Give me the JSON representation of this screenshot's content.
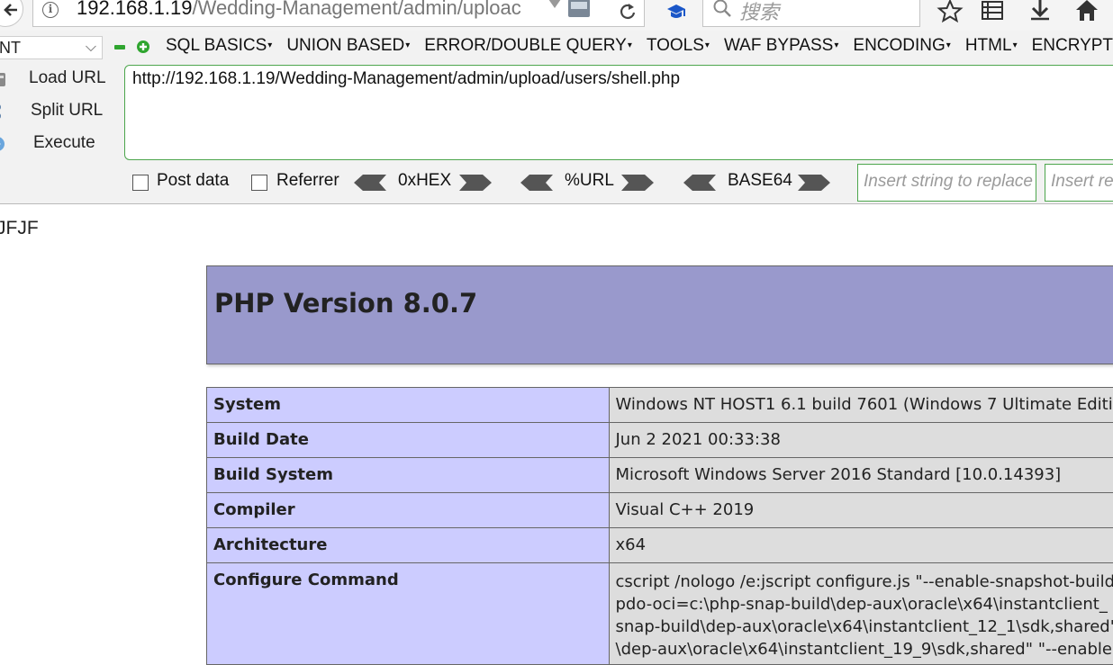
{
  "browser": {
    "url_host": "192.168.1.19",
    "url_path": "/Wedding-Management/admin/uploac",
    "search_placeholder": "搜索"
  },
  "hackbar": {
    "select_value": "NT",
    "menu": [
      "SQL BASICS",
      "UNION BASED",
      "ERROR/DOUBLE QUERY",
      "TOOLS",
      "WAF BYPASS",
      "ENCODING",
      "HTML",
      "ENCRYPTION"
    ],
    "load_url": "Load URL",
    "split_url": "Split URL",
    "execute": "Execute",
    "url_value": "http://192.168.1.19/Wedding-Management/admin/upload/users/shell.php",
    "post_data": "Post data",
    "referrer": "Referrer",
    "hex": "0xHEX",
    "url_enc": "%URL",
    "base64": "BASE64",
    "replace_placeholder": "Insert string to replace",
    "replace_with_placeholder": "Insert re"
  },
  "page": {
    "pretext": "JFJF",
    "php_title": "PHP Version 8.0.7",
    "rows": [
      {
        "key": "System",
        "value": "Windows NT HOST1 6.1 build 7601 (Windows 7 Ultimate Editi"
      },
      {
        "key": "Build Date",
        "value": "Jun 2 2021 00:33:38"
      },
      {
        "key": "Build System",
        "value": "Microsoft Windows Server 2016 Standard [10.0.14393]"
      },
      {
        "key": "Compiler",
        "value": "Visual C++ 2019"
      },
      {
        "key": "Architecture",
        "value": "x64"
      }
    ],
    "configure": {
      "key": "Configure Command",
      "lines": [
        "cscript /nologo /e:jscript configure.js \"--enable-snapshot-build",
        "pdo-oci=c:\\php-snap-build\\dep-aux\\oracle\\x64\\instantclient_",
        "snap-build\\dep-aux\\oracle\\x64\\instantclient_12_1\\sdk,shared\"",
        "\\dep-aux\\oracle\\x64\\instantclient_19_9\\sdk,shared\" \"--enable"
      ]
    }
  }
}
